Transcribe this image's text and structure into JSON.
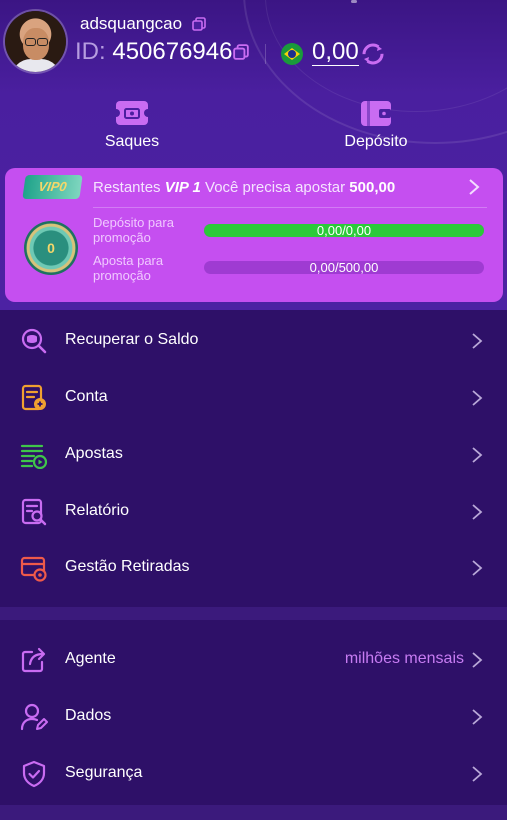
{
  "profile": {
    "username": "adsquangcao",
    "id_label": "ID:",
    "id_value": "450676946",
    "balance": "0,00"
  },
  "actions": [
    {
      "label": "Saques",
      "icon": "ticket-icon"
    },
    {
      "label": "Depósito",
      "icon": "wallet-icon"
    }
  ],
  "vip": {
    "badge": "VIP0",
    "remaining_prefix": "Restantes",
    "level": "VIP 1",
    "remaining_text": "Você precisa apostar",
    "remaining_amount": "500,00",
    "medal_level": "0",
    "deposit_label": "Depósito para promoção",
    "deposit_progress": "0,00/0,00",
    "deposit_fill_fraction": 1.0,
    "bet_label": "Aposta para promoção",
    "bet_progress": "0,00/500,00",
    "bet_fill_fraction": 0.0,
    "colors": {
      "card": "#c54ff0",
      "progress_fill": "#2cc93a",
      "progress_track": "#9f3bd2"
    }
  },
  "menu_group1": [
    {
      "label": "Recuperar o Saldo",
      "icon": "search-coins-icon",
      "color": "#c96cf2"
    },
    {
      "label": "Conta",
      "icon": "account-document-icon",
      "color": "#f0a030"
    },
    {
      "label": "Apostas",
      "icon": "bets-list-icon",
      "color": "#3fc64a"
    },
    {
      "label": "Relatório",
      "icon": "report-search-icon",
      "color": "#c96cf2"
    },
    {
      "label": "Gestão Retiradas",
      "icon": "card-settings-icon",
      "color": "#ef5a4a"
    }
  ],
  "menu_group2": [
    {
      "label": "Agente",
      "extra": "milhões mensais",
      "icon": "share-icon",
      "color": "#c96cf2"
    },
    {
      "label": "Dados",
      "icon": "user-edit-icon",
      "color": "#c96cf2"
    },
    {
      "label": "Segurança",
      "icon": "shield-check-icon",
      "color": "#c96cf2"
    }
  ]
}
